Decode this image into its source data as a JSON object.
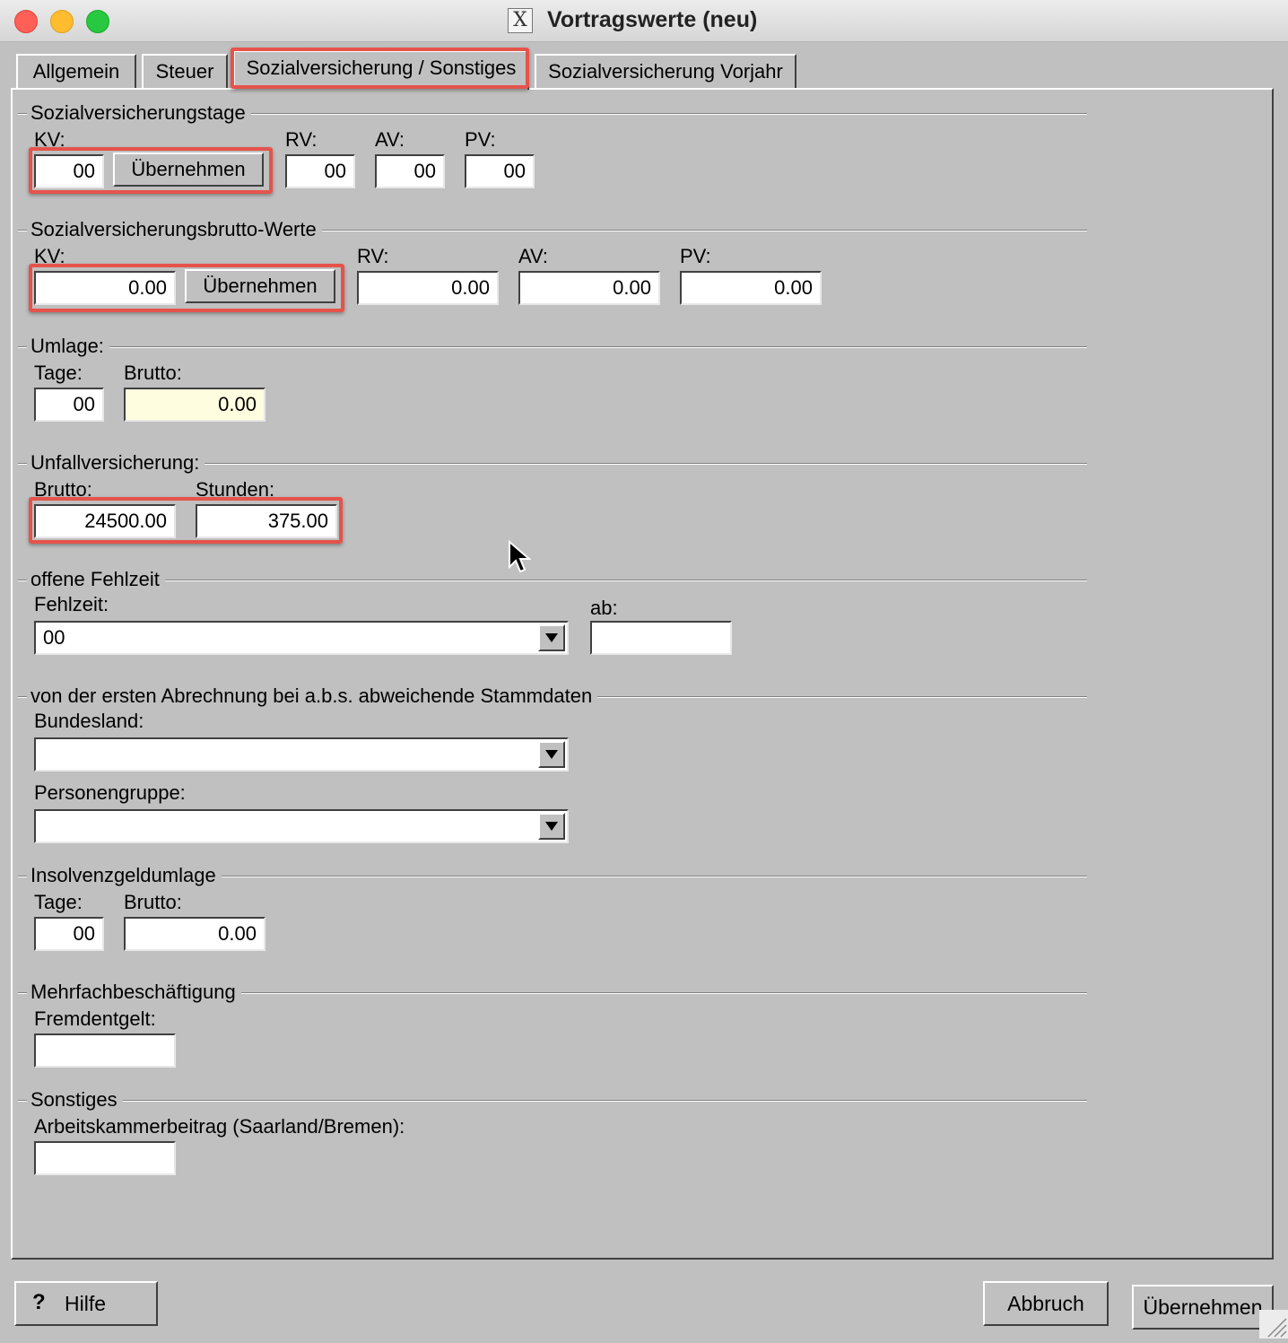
{
  "window": {
    "title": "Vortragswerte (neu)",
    "app_icon_glyph": "X"
  },
  "tabs": [
    {
      "label": "Allgemein"
    },
    {
      "label": "Steuer"
    },
    {
      "label": "Sozialversicherung / Sonstiges",
      "active": true
    },
    {
      "label": "Sozialversicherung Vorjahr"
    }
  ],
  "sv_tage": {
    "title": "Sozialversicherungstage",
    "kv_label": "KV:",
    "kv_value": "00",
    "kv_button": "Übernehmen",
    "rv_label": "RV:",
    "rv_value": "00",
    "av_label": "AV:",
    "av_value": "00",
    "pv_label": "PV:",
    "pv_value": "00"
  },
  "sv_brutto": {
    "title": "Sozialversicherungsbrutto-Werte",
    "kv_label": "KV:",
    "kv_value": "0.00",
    "kv_button": "Übernehmen",
    "rv_label": "RV:",
    "rv_value": "0.00",
    "av_label": "AV:",
    "av_value": "0.00",
    "pv_label": "PV:",
    "pv_value": "0.00"
  },
  "umlage": {
    "title": "Umlage:",
    "tage_label": "Tage:",
    "tage_value": "00",
    "brutto_label": "Brutto:",
    "brutto_value": "0.00"
  },
  "unfall": {
    "title": "Unfallversicherung:",
    "brutto_label": "Brutto:",
    "brutto_value": "24500.00",
    "stunden_label": "Stunden:",
    "stunden_value": "375.00"
  },
  "fehlzeit": {
    "title": "offene Fehlzeit",
    "fehlzeit_label": "Fehlzeit:",
    "fehlzeit_value": "00",
    "ab_label": "ab:",
    "ab_value": ""
  },
  "stammdaten": {
    "title": "von der ersten Abrechnung bei a.b.s. abweichende Stammdaten",
    "bundesland_label": "Bundesland:",
    "bundesland_value": "",
    "personengruppe_label": "Personengruppe:",
    "personengruppe_value": ""
  },
  "insolvenz": {
    "title": "Insolvenzgeldumlage",
    "tage_label": "Tage:",
    "tage_value": "00",
    "brutto_label": "Brutto:",
    "brutto_value": "0.00"
  },
  "mehrfach": {
    "title": "Mehrfachbeschäftigung",
    "fremdentgelt_label": "Fremdentgelt:",
    "fremdentgelt_value": ""
  },
  "sonstiges": {
    "title": "Sonstiges",
    "arbeitskammer_label": "Arbeitskammerbeitrag (Saarland/Bremen):",
    "arbeitskammer_value": ""
  },
  "footer": {
    "help_glyph": "?",
    "help_label": "Hilfe",
    "cancel_label": "Abbruch",
    "ok_label": "Übernehmen"
  },
  "colors": {
    "highlight": "#e5534b",
    "panel": "#c0c0c0",
    "readonly_field": "#fffde0"
  }
}
